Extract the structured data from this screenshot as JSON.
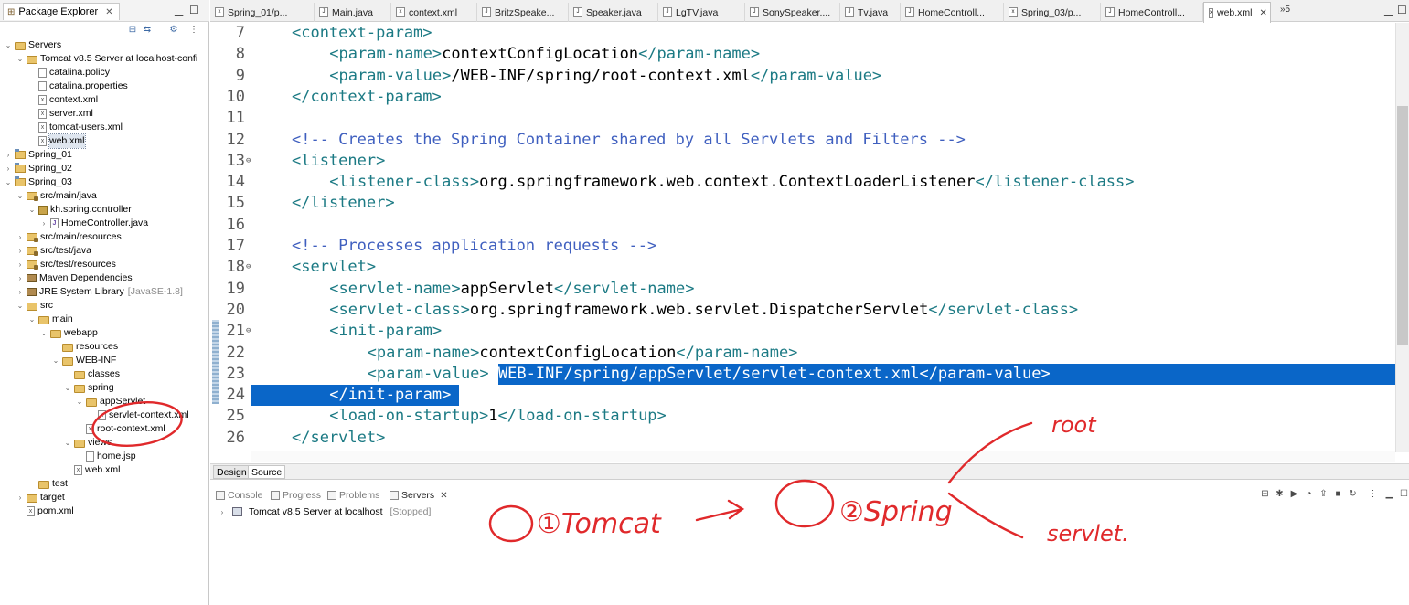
{
  "explorer": {
    "title": "Package Explorer",
    "tree": [
      {
        "label": "Servers",
        "indent": 0,
        "icon": "folder",
        "toggle": "v"
      },
      {
        "label": "Tomcat v8.5 Server at localhost-confi",
        "indent": 1,
        "icon": "folder",
        "toggle": "v"
      },
      {
        "label": "catalina.policy",
        "indent": 2,
        "icon": "file",
        "toggle": ""
      },
      {
        "label": "catalina.properties",
        "indent": 2,
        "icon": "file",
        "toggle": ""
      },
      {
        "label": "context.xml",
        "indent": 2,
        "icon": "xml",
        "toggle": ""
      },
      {
        "label": "server.xml",
        "indent": 2,
        "icon": "xml",
        "toggle": ""
      },
      {
        "label": "tomcat-users.xml",
        "indent": 2,
        "icon": "xml",
        "toggle": ""
      },
      {
        "label": "web.xml",
        "indent": 2,
        "icon": "xml",
        "toggle": "",
        "selected": true
      },
      {
        "label": "Spring_01",
        "indent": 0,
        "icon": "project",
        "toggle": ">"
      },
      {
        "label": "Spring_02",
        "indent": 0,
        "icon": "project",
        "toggle": ">"
      },
      {
        "label": "Spring_03",
        "indent": 0,
        "icon": "project",
        "toggle": "v"
      },
      {
        "label": "src/main/java",
        "indent": 1,
        "icon": "srcfolder",
        "toggle": "v"
      },
      {
        "label": "kh.spring.controller",
        "indent": 2,
        "icon": "pkg",
        "toggle": "v"
      },
      {
        "label": "HomeController.java",
        "indent": 3,
        "icon": "java",
        "toggle": ">"
      },
      {
        "label": "src/main/resources",
        "indent": 1,
        "icon": "srcfolder",
        "toggle": ">"
      },
      {
        "label": "src/test/java",
        "indent": 1,
        "icon": "srcfolder",
        "toggle": ">"
      },
      {
        "label": "src/test/resources",
        "indent": 1,
        "icon": "srcfolder",
        "toggle": ">"
      },
      {
        "label": "Maven Dependencies",
        "indent": 1,
        "icon": "lib",
        "toggle": ">"
      },
      {
        "label": "JRE System Library",
        "suffix": "[JavaSE-1.8]",
        "indent": 1,
        "icon": "lib",
        "toggle": ">"
      },
      {
        "label": "src",
        "indent": 1,
        "icon": "folder",
        "toggle": "v"
      },
      {
        "label": "main",
        "indent": 2,
        "icon": "folder",
        "toggle": "v"
      },
      {
        "label": "webapp",
        "indent": 3,
        "icon": "folder",
        "toggle": "v"
      },
      {
        "label": "resources",
        "indent": 4,
        "icon": "folder",
        "toggle": ""
      },
      {
        "label": "WEB-INF",
        "indent": 4,
        "icon": "folder",
        "toggle": "v"
      },
      {
        "label": "classes",
        "indent": 5,
        "icon": "folder",
        "toggle": ""
      },
      {
        "label": "spring",
        "indent": 5,
        "icon": "folder",
        "toggle": "v"
      },
      {
        "label": "appServlet",
        "indent": 6,
        "icon": "folder",
        "toggle": "v"
      },
      {
        "label": "servlet-context.xml",
        "indent": 7,
        "icon": "xml",
        "toggle": ""
      },
      {
        "label": "root-context.xml",
        "indent": 6,
        "icon": "xml",
        "toggle": ""
      },
      {
        "label": "views",
        "indent": 5,
        "icon": "folder",
        "toggle": "v"
      },
      {
        "label": "home.jsp",
        "indent": 6,
        "icon": "file",
        "toggle": ""
      },
      {
        "label": "web.xml",
        "indent": 5,
        "icon": "xml",
        "toggle": ""
      },
      {
        "label": "test",
        "indent": 2,
        "icon": "folder",
        "toggle": ""
      },
      {
        "label": "target",
        "indent": 1,
        "icon": "folder",
        "toggle": ">"
      },
      {
        "label": "pom.xml",
        "indent": 1,
        "icon": "xml",
        "toggle": ""
      }
    ]
  },
  "editor_tabs": [
    {
      "label": "Spring_01/p...",
      "icon": "xml"
    },
    {
      "label": "Main.java",
      "icon": "java"
    },
    {
      "label": "context.xml",
      "icon": "xml"
    },
    {
      "label": "BritzSpeake...",
      "icon": "java"
    },
    {
      "label": "Speaker.java",
      "icon": "java"
    },
    {
      "label": "LgTV.java",
      "icon": "java"
    },
    {
      "label": "SonySpeaker....",
      "icon": "java"
    },
    {
      "label": "Tv.java",
      "icon": "java"
    },
    {
      "label": "HomeControll...",
      "icon": "java"
    },
    {
      "label": "Spring_03/p...",
      "icon": "xml"
    },
    {
      "label": "HomeControll...",
      "icon": "java"
    },
    {
      "label": "web.xml",
      "icon": "xml",
      "active": true
    }
  ],
  "editor_overflow": "»5",
  "code_lines": [
    {
      "n": "7",
      "fold": "",
      "indent": 1,
      "segs": [
        [
          "tag",
          "<context-param>"
        ]
      ]
    },
    {
      "n": "8",
      "fold": "",
      "indent": 2,
      "segs": [
        [
          "tag",
          "<param-name>"
        ],
        [
          "txt",
          "contextConfigLocation"
        ],
        [
          "tag",
          "</param-name>"
        ]
      ]
    },
    {
      "n": "9",
      "fold": "",
      "indent": 2,
      "segs": [
        [
          "tag",
          "<param-value>"
        ],
        [
          "txt",
          "/WEB-INF/spring/root-context.xml"
        ],
        [
          "tag",
          "</param-value>"
        ]
      ]
    },
    {
      "n": "10",
      "fold": "",
      "indent": 1,
      "segs": [
        [
          "tag",
          "</context-param>"
        ]
      ]
    },
    {
      "n": "11",
      "fold": "",
      "indent": 0,
      "segs": []
    },
    {
      "n": "12",
      "fold": "",
      "indent": 1,
      "segs": [
        [
          "cm",
          "<!-- Creates the Spring Container shared by all Servlets and Filters -->"
        ]
      ]
    },
    {
      "n": "13",
      "fold": "⊖",
      "indent": 1,
      "segs": [
        [
          "tag",
          "<listener>"
        ]
      ]
    },
    {
      "n": "14",
      "fold": "",
      "indent": 2,
      "segs": [
        [
          "tag",
          "<listener-class>"
        ],
        [
          "txt",
          "org.springframework.web.context.ContextLoaderListener"
        ],
        [
          "tag",
          "</listener-class>"
        ]
      ]
    },
    {
      "n": "15",
      "fold": "",
      "indent": 1,
      "segs": [
        [
          "tag",
          "</listener>"
        ]
      ]
    },
    {
      "n": "16",
      "fold": "",
      "indent": 0,
      "segs": []
    },
    {
      "n": "17",
      "fold": "",
      "indent": 1,
      "segs": [
        [
          "cm",
          "<!-- Processes application requests -->"
        ]
      ]
    },
    {
      "n": "18",
      "fold": "⊖",
      "indent": 1,
      "segs": [
        [
          "tag",
          "<servlet>"
        ]
      ]
    },
    {
      "n": "19",
      "fold": "",
      "indent": 2,
      "segs": [
        [
          "tag",
          "<servlet-name>"
        ],
        [
          "txt",
          "appServlet"
        ],
        [
          "tag",
          "</servlet-name>"
        ]
      ]
    },
    {
      "n": "20",
      "fold": "",
      "indent": 2,
      "segs": [
        [
          "tag",
          "<servlet-class>"
        ],
        [
          "txt",
          "org.springframework.web.servlet.DispatcherServlet"
        ],
        [
          "tag",
          "</servlet-class>"
        ]
      ]
    },
    {
      "n": "21",
      "fold": "⊖",
      "indent": 2,
      "segs": [
        [
          "tag",
          "<init-param>"
        ]
      ]
    },
    {
      "n": "22",
      "fold": "",
      "indent": 3,
      "segs": [
        [
          "tag",
          "<param-name>"
        ],
        [
          "txt",
          "contextConfigLocation"
        ],
        [
          "tag",
          "</param-name>"
        ]
      ]
    },
    {
      "n": "23",
      "fold": "",
      "indent": 3,
      "segs": [
        [
          "tag",
          "<param-value>"
        ],
        [
          "sel",
          "/WEB-INF/spring/appServlet/servlet-context.xml</param-value>"
        ]
      ],
      "selTail": true
    },
    {
      "n": "24",
      "fold": "",
      "indent": 2,
      "segs": [
        [
          "sel",
          "</init-param>"
        ]
      ],
      "selHead": true
    },
    {
      "n": "25",
      "fold": "",
      "indent": 2,
      "segs": [
        [
          "tag",
          "<load-on-startup>"
        ],
        [
          "txt",
          "1"
        ],
        [
          "tag",
          "</load-on-startup>"
        ]
      ]
    },
    {
      "n": "26",
      "fold": "",
      "indent": 1,
      "segs": [
        [
          "tag",
          "</servlet>"
        ]
      ]
    }
  ],
  "editor_view_tabs": {
    "design": "Design",
    "source": "Source"
  },
  "bottom": {
    "tabs": [
      {
        "label": "Console",
        "active": false
      },
      {
        "label": "Progress",
        "active": false
      },
      {
        "label": "Problems",
        "active": false
      },
      {
        "label": "Servers",
        "active": true
      }
    ],
    "server_entry": "Tomcat v8.5 Server at localhost",
    "server_status": "[Stopped]"
  },
  "handwriting": {
    "step1": "①Tomcat",
    "step2": "②Spring",
    "branch_top": "root",
    "branch_bottom": "servlet."
  },
  "colors": {
    "tag": "#1c7a84",
    "comment": "#3f5fbf",
    "selection": "#0a66c8",
    "annotation": "#e0292b"
  }
}
